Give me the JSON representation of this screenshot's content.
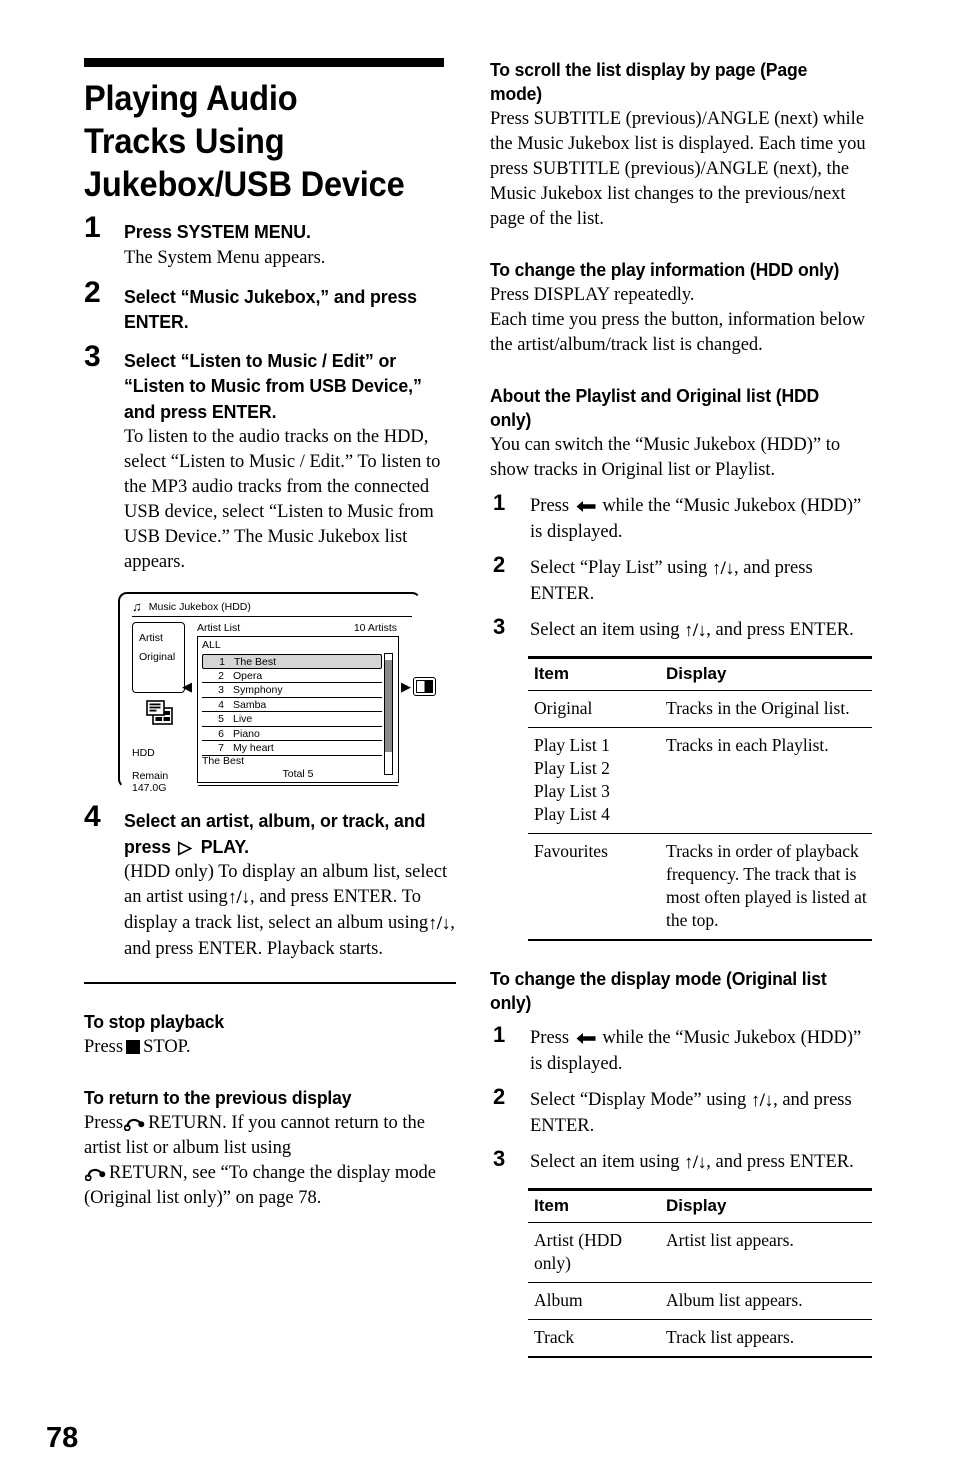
{
  "page": {
    "number": "78",
    "title": "Playing Audio Tracks Using Jukebox/USB Device"
  },
  "icons": {
    "play": "▷",
    "stop": "■",
    "up_down": "↑/↓",
    "left": "←",
    "return": "return-arrow",
    "music_note": "♫"
  },
  "left_column": {
    "steps": [
      {
        "num": "1",
        "lead": "Press SYSTEM MENU.",
        "body": "The System Menu appears."
      },
      {
        "num": "2",
        "lead": "Select “Music Jukebox,” and press ENTER.",
        "body": ""
      },
      {
        "num": "3",
        "lead": "Select “Listen to Music / Edit” or “Listen to Music from USB Device,” and press ENTER.",
        "body": "To listen to the audio tracks on the HDD, select “Listen to Music / Edit.” To listen to the MP3 audio tracks from the connected USB device, select “Listen to Music from USB Device.” The Music Jukebox list appears."
      }
    ],
    "step4": {
      "num": "4",
      "lead_before": "Select an artist, album, or track, and press",
      "lead_after": "PLAY.",
      "body_1": "(HDD only) To display an album list, select an artist using",
      "body_2": ", and press ENTER.",
      "body_3": "To display a track list, select an album using",
      "body_4": ", and press ENTER.",
      "body_5": "Playback starts."
    },
    "figure": {
      "window_title": "Music Jukebox (HDD)",
      "left_box": [
        "Artist",
        "Original"
      ],
      "list_header_left": "Artist List",
      "list_header_right": "10 Artists",
      "all_label": "ALL",
      "rows": [
        {
          "n": "1",
          "name": "The Best",
          "selected": true
        },
        {
          "n": "2",
          "name": "Opera",
          "selected": false
        },
        {
          "n": "3",
          "name": "Symphony",
          "selected": false
        },
        {
          "n": "4",
          "name": "Samba",
          "selected": false
        },
        {
          "n": "5",
          "name": "Live",
          "selected": false
        },
        {
          "n": "6",
          "name": "Piano",
          "selected": false
        },
        {
          "n": "7",
          "name": "My heart",
          "selected": false
        }
      ],
      "footer_title": "The Best",
      "footer_total": "Total 5",
      "hdd_label": "HDD",
      "remain_label": "Remain",
      "remain_value": "147.0G"
    },
    "sections": [
      {
        "heading": "To stop playback",
        "text_before": "Press",
        "text_after": "STOP."
      },
      {
        "heading": "To return to the previous display",
        "line1_before": "Press",
        "line1_after": "RETURN. If you cannot return to the artist list or album list using",
        "line2_after": "RETURN, see “To change the display mode (Original list only)” on page 78."
      }
    ]
  },
  "right_column": {
    "section_page_mode": {
      "heading": "To scroll the list display by page (Page mode)",
      "paragraph": "Press SUBTITLE (previous)/ANGLE (next) while the Music Jukebox list is displayed. Each time you press SUBTITLE (previous)/ANGLE (next), the Music Jukebox list changes to the previous/next page of the list."
    },
    "section_play_info": {
      "heading": "To change the play information (HDD only)",
      "paragraph_1": "Press DISPLAY repeatedly.",
      "paragraph_2": "Each time you press the button, information below the artist/album/track list is changed."
    },
    "section_playlist": {
      "heading": "About the Playlist and Original list (HDD only)",
      "paragraph": "You can switch the “Music Jukebox (HDD)” to show tracks in Original list or Playlist.",
      "steps": [
        {
          "num": "1",
          "before": "Press",
          "after": "while the “Music Jukebox (HDD)” is displayed."
        },
        {
          "num": "2",
          "before": "Select “Play List” using",
          "after": ", and press ENTER."
        },
        {
          "num": "3",
          "before": "Select an item using",
          "after": ", and press ENTER."
        }
      ],
      "table": {
        "headers": [
          "Item",
          "Display"
        ],
        "rows": [
          {
            "item": "Original",
            "display": "Tracks in the Original list."
          },
          {
            "item": "Play List 1\nPlay List 2\nPlay List 3\nPlay List 4",
            "display": "Tracks in each Playlist."
          },
          {
            "item": "Favourites",
            "display": "Tracks in order of playback frequency. The track that is most often played is listed at the top."
          }
        ]
      }
    },
    "section_display_mode": {
      "heading": "To change the display mode (Original list only)",
      "steps": [
        {
          "num": "1",
          "before": "Press",
          "after": "while the “Music Jukebox (HDD)” is displayed."
        },
        {
          "num": "2",
          "before": "Select “Display Mode” using",
          "after": ", and press ENTER."
        },
        {
          "num": "3",
          "before": "Select an item using",
          "after": ", and press ENTER."
        }
      ],
      "table": {
        "headers": [
          "Item",
          "Display"
        ],
        "rows": [
          {
            "item": "Artist (HDD only)",
            "display": "Artist list appears."
          },
          {
            "item": "Album",
            "display": "Album list appears."
          },
          {
            "item": "Track",
            "display": "Track list appears."
          }
        ]
      }
    }
  }
}
